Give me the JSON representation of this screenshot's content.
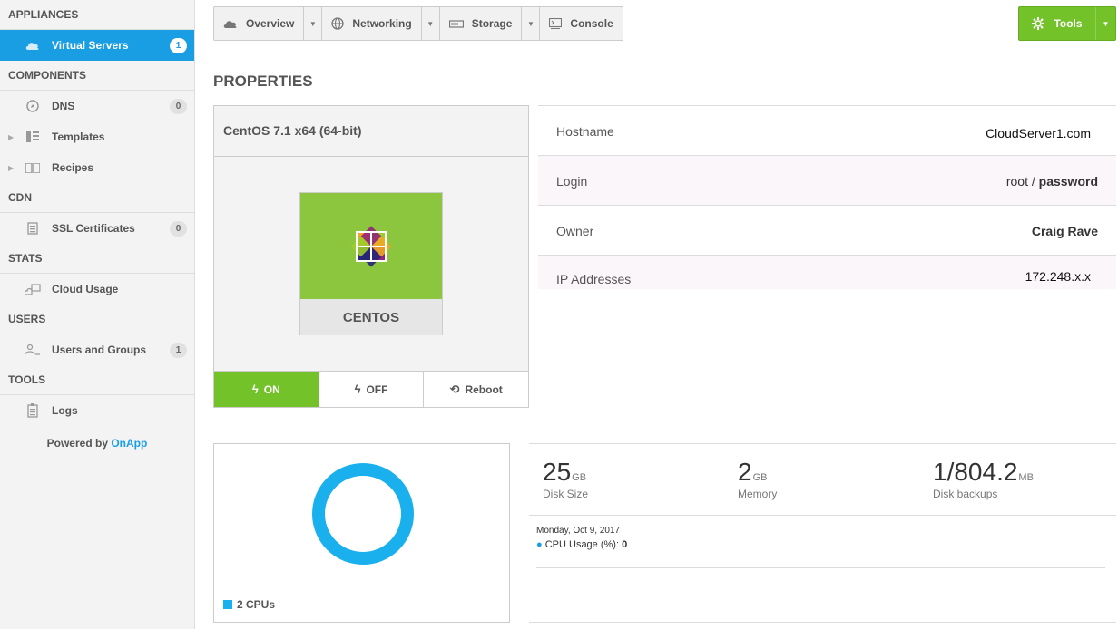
{
  "sidebar": {
    "sections": {
      "appliances": "APPLIANCES",
      "components": "COMPONENTS",
      "cdn": "CDN",
      "stats": "STATS",
      "users": "USERS",
      "tools": "TOOLS"
    },
    "items": {
      "virtual_servers": {
        "label": "Virtual Servers",
        "badge": "1",
        "icon": "cloud-icon"
      },
      "dns": {
        "label": "DNS",
        "badge": "0",
        "icon": "compass-icon"
      },
      "templates": {
        "label": "Templates",
        "icon": "templates-icon"
      },
      "recipes": {
        "label": "Recipes",
        "icon": "book-icon"
      },
      "ssl": {
        "label": "SSL Certificates",
        "badge": "0",
        "icon": "certificate-icon"
      },
      "cloud_usage": {
        "label": "Cloud Usage",
        "icon": "cloud-usage-icon"
      },
      "users_groups": {
        "label": "Users and Groups",
        "badge": "1",
        "icon": "users-icon"
      },
      "logs": {
        "label": "Logs",
        "icon": "clipboard-icon"
      }
    },
    "powered_prefix": "Powered by",
    "powered_brand": "OnApp"
  },
  "topnav": {
    "overview": "Overview",
    "networking": "Networking",
    "storage": "Storage",
    "console": "Console",
    "tools": "Tools"
  },
  "page_title": "PROPERTIES",
  "os": {
    "name": "CentOS 7.1 x64 (64-bit)",
    "logo_label": "CENTOS",
    "on": "ON",
    "off": "OFF",
    "reboot": "Reboot"
  },
  "properties": {
    "hostname_key": "Hostname",
    "hostname_val": "CloudServer1.com",
    "login_key": "Login",
    "login_user": "root",
    "login_sep": " / ",
    "login_pass": "password",
    "owner_key": "Owner",
    "owner_val": "Craig Rave",
    "ip_key": "IP Addresses",
    "ip_val": "172.248.x.x"
  },
  "cpu": {
    "legend": "2 CPUs",
    "color": "#1ab0ee"
  },
  "stats": {
    "disk": {
      "value": "25",
      "unit": "GB",
      "caption": "Disk Size"
    },
    "memory": {
      "value": "2",
      "unit": "GB",
      "caption": "Memory"
    },
    "backups": {
      "value": "1/804.2",
      "unit": "MB",
      "caption": "Disk backups"
    }
  },
  "cpu_chart": {
    "date": "Monday, Oct 9, 2017",
    "usage_label": "CPU Usage (%):",
    "usage_value": "0"
  },
  "colors": {
    "accent": "#1a9ee3",
    "green": "#74c22a"
  }
}
